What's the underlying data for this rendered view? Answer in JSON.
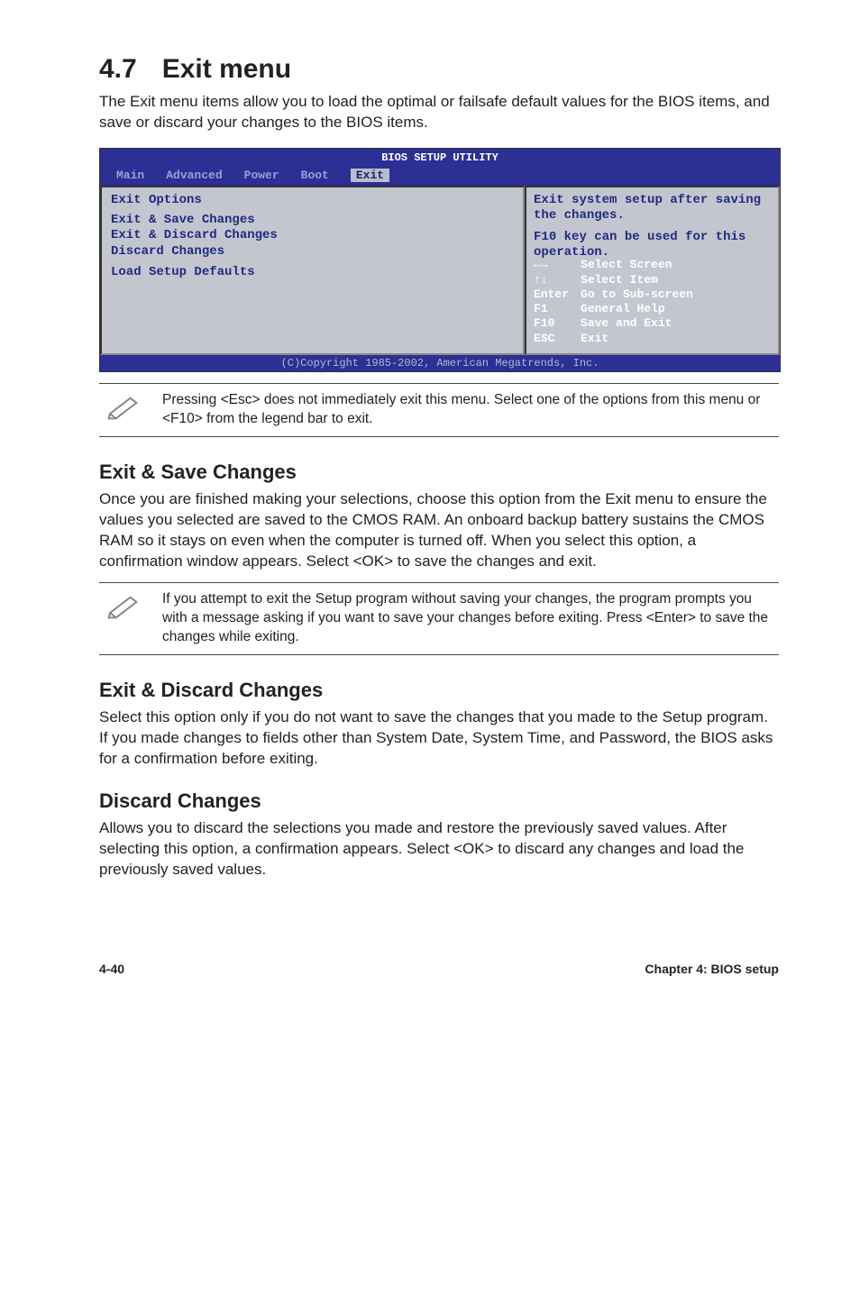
{
  "heading": {
    "num": "4.7",
    "title": "Exit menu"
  },
  "intro": "The Exit menu items allow you to load the optimal or failsafe default values for the BIOS items, and save or discard your changes to the BIOS items.",
  "bios": {
    "utility_title": "BIOS SETUP UTILITY",
    "menubar": [
      "Main",
      "Advanced",
      "Power",
      "Boot",
      "Exit"
    ],
    "active_tab": "Exit",
    "left": {
      "heading": "Exit Options",
      "items": [
        "Exit & Save Changes",
        "Exit & Discard Changes",
        "Discard Changes",
        "",
        "Load Setup Defaults"
      ]
    },
    "right": {
      "help1": "Exit system setup after saving the changes.",
      "help2": "F10 key can be used for this operation.",
      "keys": [
        {
          "k": "←→",
          "d": "Select Screen"
        },
        {
          "k": "↑↓",
          "d": "Select Item"
        },
        {
          "k": "Enter",
          "d": "Go to Sub-screen"
        },
        {
          "k": "F1",
          "d": "General Help"
        },
        {
          "k": "F10",
          "d": "Save and Exit"
        },
        {
          "k": "ESC",
          "d": "Exit"
        }
      ]
    },
    "footer": "(C)Copyright 1985-2002, American Megatrends, Inc."
  },
  "note1": "Pressing <Esc> does not immediately exit this menu. Select one of the options from this menu or <F10> from the legend bar to exit.",
  "sections": {
    "save": {
      "title": "Exit & Save Changes",
      "body": "Once you are finished making your selections, choose this option from the Exit menu to ensure the values you selected are saved to the CMOS RAM. An onboard backup battery sustains the CMOS RAM so it stays on even when the computer is turned off. When you select this option, a confirmation window appears. Select <OK> to save the changes and exit."
    },
    "note2": "If you attempt to exit the Setup program without saving your changes, the program prompts you with a message asking if you want to save your changes before exiting. Press <Enter> to save the changes while exiting.",
    "discard": {
      "title": "Exit & Discard Changes",
      "body": "Select this option only if you do not want to save the changes that you made to the Setup program. If you made changes to fields other than System Date, System Time, and Password, the BIOS asks for a confirmation before exiting."
    },
    "discard2": {
      "title": "Discard Changes",
      "body": "Allows you to discard the selections you made and restore the previously saved values. After selecting this option, a confirmation appears. Select <OK> to discard any changes and load the previously saved values."
    }
  },
  "footer": {
    "left": "4-40",
    "right": "Chapter 4: BIOS setup"
  }
}
